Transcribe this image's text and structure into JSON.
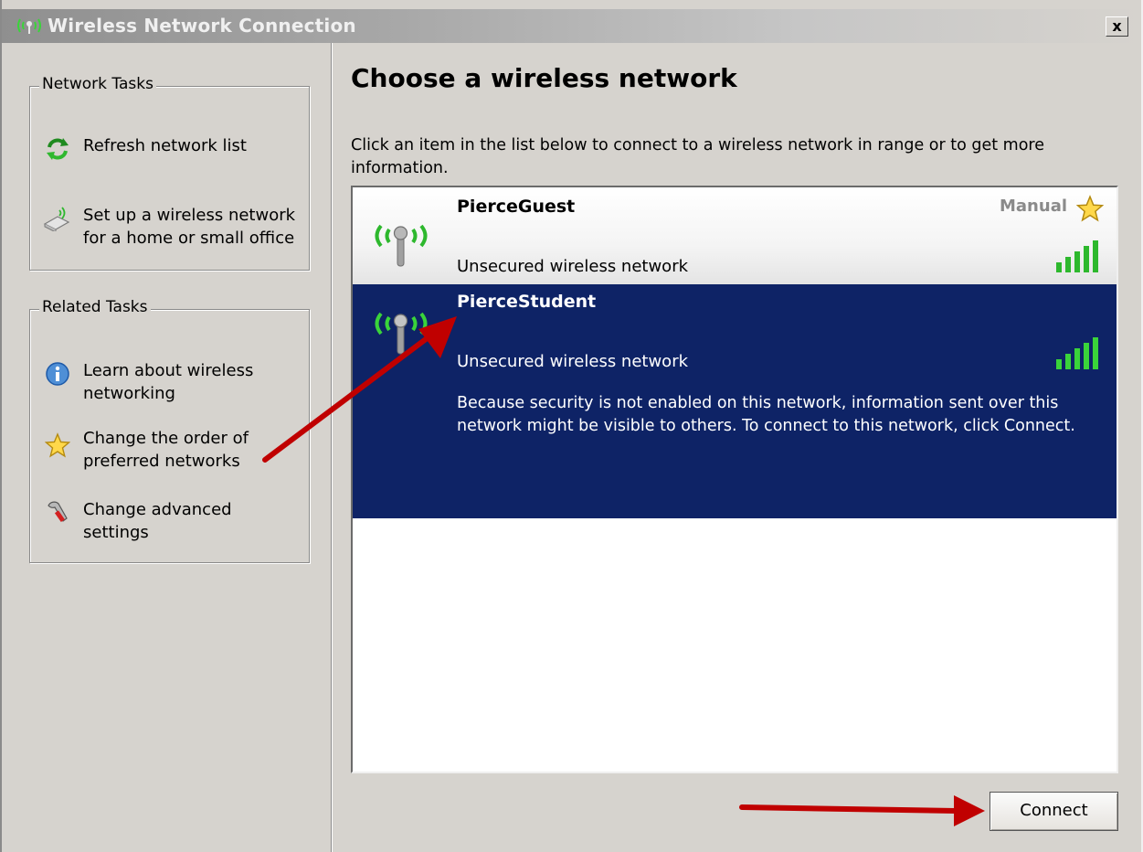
{
  "window": {
    "title": "Wireless Network Connection",
    "close_glyph": "x",
    "title_icon": "wireless-icon"
  },
  "network_tasks": {
    "title": "Network Tasks",
    "items": [
      {
        "label": "Refresh network list",
        "icon": "refresh-icon"
      },
      {
        "label": "Set up a wireless network\nfor a home or small office",
        "icon": "wireless-setup-icon"
      }
    ]
  },
  "related_tasks": {
    "title": "Related Tasks",
    "items": [
      {
        "label": "Learn about wireless\nnetworking",
        "icon": "info-icon"
      },
      {
        "label": "Change the order of\npreferred networks",
        "icon": "star-icon"
      },
      {
        "label": "Change advanced\nsettings",
        "icon": "settings-icon"
      }
    ]
  },
  "main": {
    "title": "Choose a wireless network",
    "instructions": "Click an item in the list below to connect to a wireless network in range or to get more information."
  },
  "networks": [
    {
      "name": "PierceGuest",
      "status": "Unsecured wireless network",
      "tag": "Manual",
      "tag_icon": "star-icon",
      "signal_bars": 5,
      "selected": false
    },
    {
      "name": "PierceStudent",
      "status": "Unsecured wireless network",
      "description": "Because security is not enabled on this network, information sent over this network might be visible to others. To connect to this network, click Connect.",
      "signal_bars": 5,
      "selected": true
    }
  ],
  "buttons": {
    "connect": "Connect"
  },
  "colors": {
    "selection": "#0e2366",
    "signal_green": "#2db82d",
    "annotation_arrow": "#c00000"
  }
}
